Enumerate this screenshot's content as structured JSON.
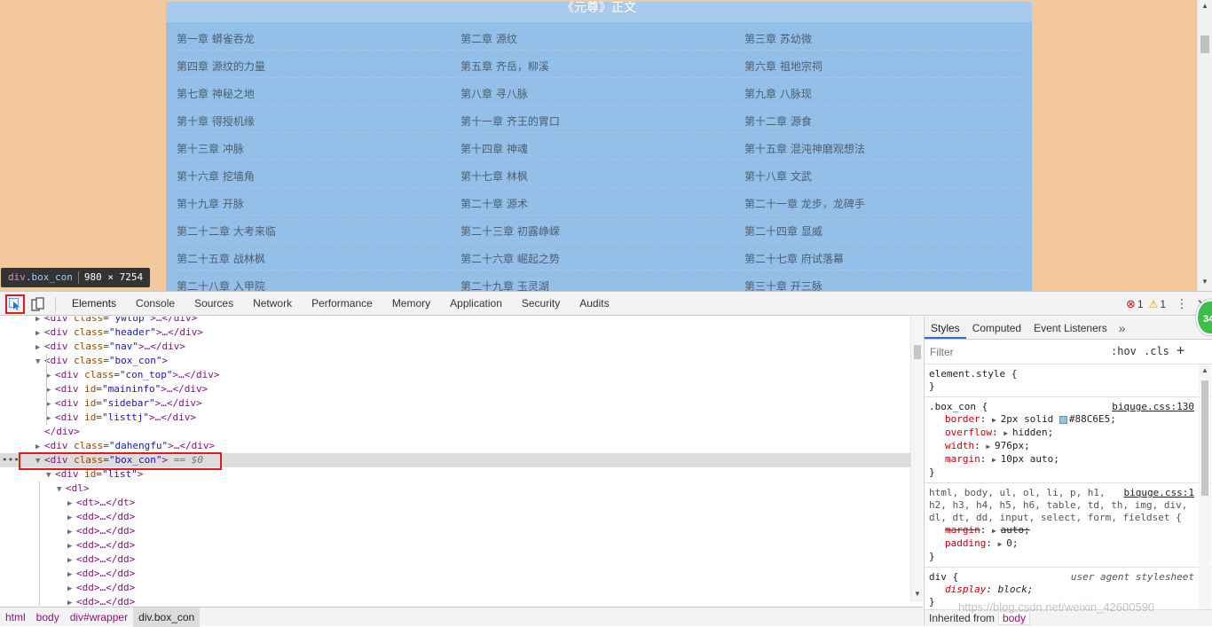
{
  "page": {
    "section_title": "《元尊》正文",
    "chapters": [
      [
        "第一章 蟒雀吞龙",
        "第二章 源纹",
        "第三章 苏幼微"
      ],
      [
        "第四章 源纹的力量",
        "第五章 齐岳，柳溪",
        "第六章 祖地宗祠"
      ],
      [
        "第七章 神秘之地",
        "第八章 寻八脉",
        "第九章 八脉现"
      ],
      [
        "第十章 得授机缘",
        "第十一章 齐王的胃口",
        "第十二章 源食"
      ],
      [
        "第十三章 冲脉",
        "第十四章 神魂",
        "第十五章 混沌神磨观想法"
      ],
      [
        "第十六章 挖墙角",
        "第十七章 林枫",
        "第十八章 文武"
      ],
      [
        "第十九章 开脉",
        "第二十章 源术",
        "第二十一章 龙步，龙碑手"
      ],
      [
        "第二十二章 大考来临",
        "第二十三章 初露峥嵘",
        "第二十四章 显威"
      ],
      [
        "第二十五章 战林枫",
        "第二十六章 崛起之势",
        "第二十七章 府试落幕"
      ],
      [
        "第二十八章 入甲院",
        "第二十九章 玉灵湖",
        "第三十章 开三脉"
      ]
    ],
    "tooltip": {
      "tag": "div",
      "cls": ".box_con",
      "size": "980 × 7254"
    }
  },
  "devtools": {
    "tabs": [
      "Elements",
      "Console",
      "Sources",
      "Network",
      "Performance",
      "Memory",
      "Application",
      "Security",
      "Audits"
    ],
    "active_tab": "Elements",
    "error_count": "1",
    "warning_count": "1",
    "tree": [
      {
        "indent": 0,
        "tri": "▶",
        "parts": [
          [
            "t",
            "<div "
          ],
          [
            "a",
            "class"
          ],
          [
            "t",
            "="
          ],
          [
            "v",
            "\"ywtop\""
          ],
          [
            "t",
            ">…</div>"
          ]
        ]
      },
      {
        "indent": 0,
        "tri": "▶",
        "parts": [
          [
            "t",
            "<div "
          ],
          [
            "a",
            "class"
          ],
          [
            "t",
            "="
          ],
          [
            "v",
            "\"header\""
          ],
          [
            "t",
            ">…</div>"
          ]
        ]
      },
      {
        "indent": 0,
        "tri": "▶",
        "parts": [
          [
            "t",
            "<div "
          ],
          [
            "a",
            "class"
          ],
          [
            "t",
            "="
          ],
          [
            "v",
            "\"nav\""
          ],
          [
            "t",
            ">…</div>"
          ]
        ]
      },
      {
        "indent": 0,
        "tri": "▼",
        "parts": [
          [
            "t",
            "<div "
          ],
          [
            "a",
            "class"
          ],
          [
            "t",
            "="
          ],
          [
            "v",
            "\"box_con\""
          ],
          [
            "t",
            ">"
          ]
        ]
      },
      {
        "indent": 1,
        "tri": "▶",
        "parts": [
          [
            "t",
            "<div "
          ],
          [
            "a",
            "class"
          ],
          [
            "t",
            "="
          ],
          [
            "v",
            "\"con_top\""
          ],
          [
            "t",
            ">…</div>"
          ]
        ]
      },
      {
        "indent": 1,
        "tri": "▶",
        "parts": [
          [
            "t",
            "<div "
          ],
          [
            "a",
            "id"
          ],
          [
            "t",
            "="
          ],
          [
            "v",
            "\"maininfo\""
          ],
          [
            "t",
            ">…</div>"
          ]
        ]
      },
      {
        "indent": 1,
        "tri": "▶",
        "parts": [
          [
            "t",
            "<div "
          ],
          [
            "a",
            "id"
          ],
          [
            "t",
            "="
          ],
          [
            "v",
            "\"sidebar\""
          ],
          [
            "t",
            ">…</div>"
          ]
        ]
      },
      {
        "indent": 1,
        "tri": "▶",
        "parts": [
          [
            "t",
            "<div "
          ],
          [
            "a",
            "id"
          ],
          [
            "t",
            "="
          ],
          [
            "v",
            "\"listtj\""
          ],
          [
            "t",
            ">…</div>"
          ]
        ]
      },
      {
        "indent": 0,
        "tri": "",
        "parts": [
          [
            "t",
            "</div>"
          ]
        ]
      },
      {
        "indent": 0,
        "tri": "▶",
        "parts": [
          [
            "t",
            "<div "
          ],
          [
            "a",
            "class"
          ],
          [
            "t",
            "="
          ],
          [
            "v",
            "\"dahengfu\""
          ],
          [
            "t",
            ">…</div>"
          ]
        ]
      },
      {
        "indent": 0,
        "tri": "▼",
        "selected": true,
        "parts": [
          [
            "t",
            "<div "
          ],
          [
            "a",
            "class"
          ],
          [
            "t",
            "="
          ],
          [
            "v",
            "\"box_con\""
          ],
          [
            "t",
            ">"
          ],
          [
            "e",
            " == $0"
          ]
        ]
      },
      {
        "indent": 1,
        "tri": "▼",
        "parts": [
          [
            "t",
            "<div "
          ],
          [
            "a",
            "id"
          ],
          [
            "t",
            "="
          ],
          [
            "v",
            "\"list\""
          ],
          [
            "t",
            ">"
          ]
        ]
      },
      {
        "indent": 2,
        "tri": "▼",
        "parts": [
          [
            "t",
            "<dl>"
          ]
        ]
      },
      {
        "indent": 3,
        "tri": "▶",
        "parts": [
          [
            "t",
            "<dt>…</dt>"
          ]
        ]
      },
      {
        "indent": 3,
        "tri": "▶",
        "parts": [
          [
            "t",
            "<dd>…</dd>"
          ]
        ]
      },
      {
        "indent": 3,
        "tri": "▶",
        "parts": [
          [
            "t",
            "<dd>…</dd>"
          ]
        ]
      },
      {
        "indent": 3,
        "tri": "▶",
        "parts": [
          [
            "t",
            "<dd>…</dd>"
          ]
        ]
      },
      {
        "indent": 3,
        "tri": "▶",
        "parts": [
          [
            "t",
            "<dd>…</dd>"
          ]
        ]
      },
      {
        "indent": 3,
        "tri": "▶",
        "parts": [
          [
            "t",
            "<dd>…</dd>"
          ]
        ]
      },
      {
        "indent": 3,
        "tri": "▶",
        "parts": [
          [
            "t",
            "<dd>…</dd>"
          ]
        ]
      },
      {
        "indent": 3,
        "tri": "▶",
        "parts": [
          [
            "t",
            "<dd>…</dd>"
          ]
        ]
      }
    ],
    "breadcrumb": [
      "html",
      "body",
      "div#wrapper",
      "div.box_con"
    ],
    "styles": {
      "tabs": [
        "Styles",
        "Computed",
        "Event Listeners"
      ],
      "more": "»",
      "filter_placeholder": "Filter",
      "hov": ":hov",
      "cls": ".cls",
      "add": "+",
      "element_style": "element.style {",
      "close_brace": "}",
      "box_con_selector": ".box_con {",
      "box_con_source": "biquge.css:130",
      "box_con_decls": [
        {
          "prop": "border",
          "val": "2px solid",
          "swatch": true,
          "val2": "#88C6E5;"
        },
        {
          "prop": "overflow",
          "val": "hidden;"
        },
        {
          "prop": "width",
          "val": "976px;"
        },
        {
          "prop": "margin",
          "val": "10px auto;"
        }
      ],
      "reset_selector_1": "html, body, ul, ol, li, p, h1,",
      "reset_selector_2": "h2, h3, h4, h5, h6, table, td, th, img, div,",
      "reset_selector_3": "dl, dt, dd, input, select, form, fieldset {",
      "reset_source": "biquge.css:1",
      "reset_decls": [
        {
          "prop": "margin",
          "val": "auto;",
          "strike": true
        },
        {
          "prop": "padding",
          "val": "0;"
        }
      ],
      "div_selector": "div {",
      "div_source": "user agent stylesheet",
      "div_decl_prop": "display",
      "div_decl_val": "block;",
      "inherited_label": "Inherited from",
      "inherited_from": "body"
    },
    "watermark": "https://blog.csdn.net/weixin_42600590",
    "green_badge": "34"
  },
  "colors": {
    "page_bg": "#f2c89c",
    "box_bg": "#93bfe8",
    "border": "#88c6e5",
    "highlight_red": "#e01b1b"
  }
}
